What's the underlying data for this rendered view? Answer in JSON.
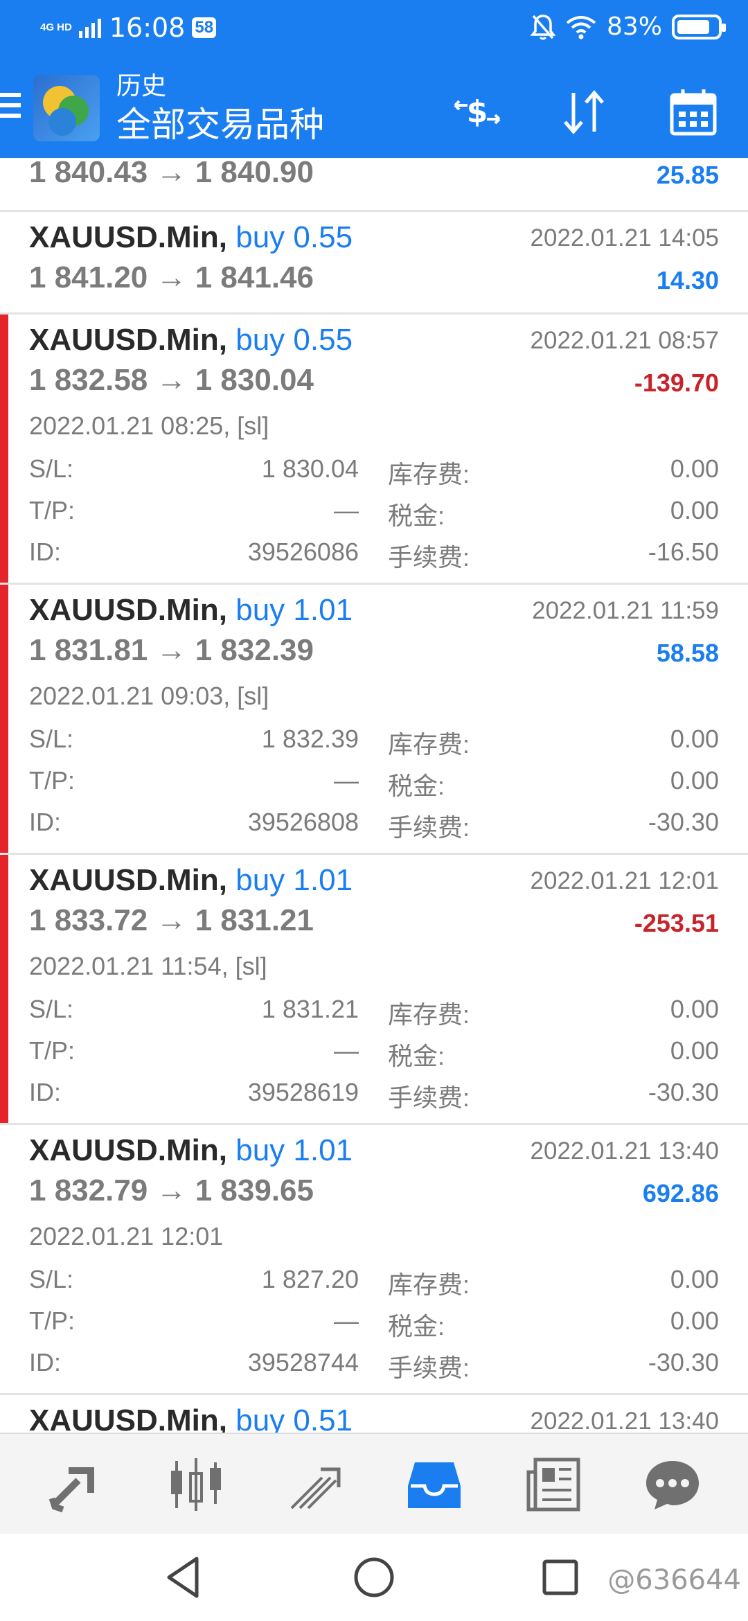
{
  "status_bar": {
    "network": "4G HD",
    "time": "16:08",
    "badge": "58",
    "battery": "83%",
    "battery_level": 0.83
  },
  "app_bar": {
    "title": "历史",
    "subtitle": "全部交易品种"
  },
  "history": {
    "partial_top": {
      "price": "1 840.43 → 1 840.90",
      "profit": "25.85"
    },
    "rows": [
      {
        "symbol": "XAUUSD.Min,",
        "side": "buy 0.55",
        "close_time": "2022.01.21 14:05",
        "price": "1 841.20 → 1 841.46",
        "profit": "14.30",
        "profit_sign": "pos",
        "expanded": false
      },
      {
        "symbol": "XAUUSD.Min,",
        "side": "buy 0.55",
        "close_time": "2022.01.21 08:57",
        "price": "1 832.58 → 1 830.04",
        "profit": "-139.70",
        "profit_sign": "neg",
        "expanded": true,
        "open_time": "2022.01.21 08:25, [sl]",
        "sl_label": "S/L:",
        "sl": "1 830.04",
        "tp_label": "T/P:",
        "tp": "—",
        "id_label": "ID:",
        "id": "39526086",
        "swap_label": "库存费:",
        "swap": "0.00",
        "tax_label": "税金:",
        "tax": "0.00",
        "commission_label": "手续费:",
        "commission": "-16.50"
      },
      {
        "symbol": "XAUUSD.Min,",
        "side": "buy 1.01",
        "close_time": "2022.01.21 11:59",
        "price": "1 831.81 → 1 832.39",
        "profit": "58.58",
        "profit_sign": "pos",
        "expanded": true,
        "open_time": "2022.01.21 09:03, [sl]",
        "sl_label": "S/L:",
        "sl": "1 832.39",
        "tp_label": "T/P:",
        "tp": "—",
        "id_label": "ID:",
        "id": "39526808",
        "swap_label": "库存费:",
        "swap": "0.00",
        "tax_label": "税金:",
        "tax": "0.00",
        "commission_label": "手续费:",
        "commission": "-30.30"
      },
      {
        "symbol": "XAUUSD.Min,",
        "side": "buy 1.01",
        "close_time": "2022.01.21 12:01",
        "price": "1 833.72 → 1 831.21",
        "profit": "-253.51",
        "profit_sign": "neg",
        "expanded": true,
        "open_time": "2022.01.21 11:54, [sl]",
        "sl_label": "S/L:",
        "sl": "1 831.21",
        "tp_label": "T/P:",
        "tp": "—",
        "id_label": "ID:",
        "id": "39528619",
        "swap_label": "库存费:",
        "swap": "0.00",
        "tax_label": "税金:",
        "tax": "0.00",
        "commission_label": "手续费:",
        "commission": "-30.30"
      },
      {
        "symbol": "XAUUSD.Min,",
        "side": "buy 1.01",
        "close_time": "2022.01.21 13:40",
        "price": "1 832.79 → 1 839.65",
        "profit": "692.86",
        "profit_sign": "pos",
        "expanded": true,
        "open_time": "2022.01.21 12:01",
        "sl_label": "S/L:",
        "sl": "1 827.20",
        "tp_label": "T/P:",
        "tp": "—",
        "id_label": "ID:",
        "id": "39528744",
        "swap_label": "库存费:",
        "swap": "0.00",
        "tax_label": "税金:",
        "tax": "0.00",
        "commission_label": "手续费:",
        "commission": "-30.30"
      }
    ],
    "partial_bottom": {
      "symbol": "XAUUSD.Min,",
      "side": "buy 0.51",
      "close_time": "2022.01.21 13:40"
    }
  },
  "bottom_nav": {
    "items": [
      "quotes-icon",
      "chart-icon",
      "trade-icon",
      "history-icon",
      "news-icon",
      "chat-icon"
    ],
    "active_color": "#1a7ef0",
    "inactive_color": "#707070"
  },
  "watermark": "@636644",
  "colors": {
    "accent": "#1a7ef0",
    "loss": "#c8232b",
    "selected_bar": "#e5232b"
  }
}
